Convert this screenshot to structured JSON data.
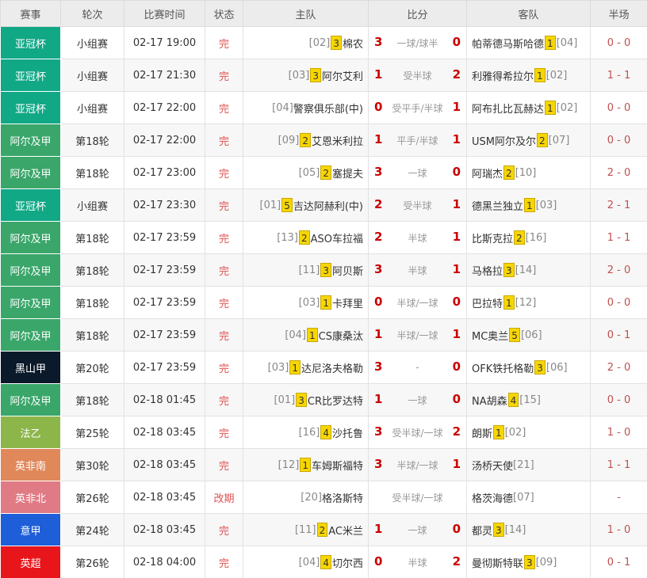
{
  "headers": [
    "赛事",
    "轮次",
    "比赛时间",
    "状态",
    "主队",
    "比分",
    "客队",
    "半场"
  ],
  "colors": {
    "league_afc": "#11a886",
    "league_algeria": "#3aa66a",
    "league_montenegro": "#0b1a2a",
    "league_ligue2": "#8cb64a",
    "league_eng_south": "#e0885a",
    "league_eng_north": "#e07a85",
    "league_serie_a": "#1e5ed8",
    "league_premier": "#e8161b",
    "badge_yellow": "#f7d600",
    "score_red": "#cc0000"
  },
  "matches": [
    {
      "league": "亚冠杯",
      "league_color": "#11a886",
      "round": "小组赛",
      "time": "02-17 19:00",
      "status": "完",
      "home_rank": "[02]",
      "home_badge": "3",
      "home": "棉农",
      "home_score": "3",
      "handicap": "一球/球半",
      "away_score": "0",
      "away": "帕蒂德马斯哈德",
      "away_badge": "1",
      "away_rank": "[04]",
      "half": "0 - 0"
    },
    {
      "league": "亚冠杯",
      "league_color": "#11a886",
      "round": "小组赛",
      "time": "02-17 21:30",
      "status": "完",
      "home_rank": "[03]",
      "home_badge": "3",
      "home": "阿尔艾利",
      "home_score": "1",
      "handicap": "受半球",
      "away_score": "2",
      "away": "利雅得希拉尔",
      "away_badge": "1",
      "away_rank": "[02]",
      "half": "1 - 1"
    },
    {
      "league": "亚冠杯",
      "league_color": "#11a886",
      "round": "小组赛",
      "time": "02-17 22:00",
      "status": "完",
      "home_rank": "[04]",
      "home_badge": "",
      "home": "警察俱乐部(中)",
      "home_score": "0",
      "handicap": "受平手/半球",
      "away_score": "1",
      "away": "阿布扎比瓦赫达",
      "away_badge": "1",
      "away_rank": "[02]",
      "half": "0 - 0"
    },
    {
      "league": "阿尔及甲",
      "league_color": "#3aa66a",
      "round": "第18轮",
      "time": "02-17 22:00",
      "status": "完",
      "home_rank": "[09]",
      "home_badge": "2",
      "home": "艾恩米利拉",
      "home_score": "1",
      "handicap": "平手/半球",
      "away_score": "1",
      "away": "USM阿尔及尔",
      "away_badge": "2",
      "away_rank": "[07]",
      "half": "0 - 0"
    },
    {
      "league": "阿尔及甲",
      "league_color": "#3aa66a",
      "round": "第18轮",
      "time": "02-17 23:00",
      "status": "完",
      "home_rank": "[05]",
      "home_badge": "2",
      "home": "塞提夫",
      "home_score": "3",
      "handicap": "一球",
      "away_score": "0",
      "away": "阿瑞杰",
      "away_badge": "2",
      "away_rank": "[10]",
      "half": "2 - 0"
    },
    {
      "league": "亚冠杯",
      "league_color": "#11a886",
      "round": "小组赛",
      "time": "02-17 23:30",
      "status": "完",
      "home_rank": "[01]",
      "home_badge": "5",
      "home": "吉达阿赫利(中)",
      "home_score": "2",
      "handicap": "受半球",
      "away_score": "1",
      "away": "德黑兰独立",
      "away_badge": "1",
      "away_rank": "[03]",
      "half": "2 - 1"
    },
    {
      "league": "阿尔及甲",
      "league_color": "#3aa66a",
      "round": "第18轮",
      "time": "02-17 23:59",
      "status": "完",
      "home_rank": "[13]",
      "home_badge": "2",
      "home": "ASO车拉福",
      "home_score": "2",
      "handicap": "半球",
      "away_score": "1",
      "away": "比斯克拉",
      "away_badge": "2",
      "away_rank": "[16]",
      "half": "1 - 1"
    },
    {
      "league": "阿尔及甲",
      "league_color": "#3aa66a",
      "round": "第18轮",
      "time": "02-17 23:59",
      "status": "完",
      "home_rank": "[11]",
      "home_badge": "3",
      "home": "阿贝斯",
      "home_score": "3",
      "handicap": "半球",
      "away_score": "1",
      "away": "马格拉",
      "away_badge": "3",
      "away_rank": "[14]",
      "half": "2 - 0"
    },
    {
      "league": "阿尔及甲",
      "league_color": "#3aa66a",
      "round": "第18轮",
      "time": "02-17 23:59",
      "status": "完",
      "home_rank": "[03]",
      "home_badge": "1",
      "home": "卡拜里",
      "home_score": "0",
      "handicap": "半球/一球",
      "away_score": "0",
      "away": "巴拉特",
      "away_badge": "1",
      "away_rank": "[12]",
      "half": "0 - 0"
    },
    {
      "league": "阿尔及甲",
      "league_color": "#3aa66a",
      "round": "第18轮",
      "time": "02-17 23:59",
      "status": "完",
      "home_rank": "[04]",
      "home_badge": "1",
      "home": "CS康桑汰",
      "home_score": "1",
      "handicap": "半球/一球",
      "away_score": "1",
      "away": "MC奥兰",
      "away_badge": "5",
      "away_rank": "[06]",
      "half": "0 - 1"
    },
    {
      "league": "黑山甲",
      "league_color": "#0b1a2a",
      "round": "第20轮",
      "time": "02-17 23:59",
      "status": "完",
      "home_rank": "[03]",
      "home_badge": "1",
      "home": "达尼洛夫格勒",
      "home_score": "3",
      "handicap": "-",
      "away_score": "0",
      "away": "OFK铁托格勒",
      "away_badge": "3",
      "away_rank": "[06]",
      "half": "2 - 0"
    },
    {
      "league": "阿尔及甲",
      "league_color": "#3aa66a",
      "round": "第18轮",
      "time": "02-18 01:45",
      "status": "完",
      "home_rank": "[01]",
      "home_badge": "3",
      "home": "CR比罗达特",
      "home_score": "1",
      "handicap": "一球",
      "away_score": "0",
      "away": "NA胡森",
      "away_badge": "4",
      "away_rank": "[15]",
      "half": "0 - 0"
    },
    {
      "league": "法乙",
      "league_color": "#8cb64a",
      "round": "第25轮",
      "time": "02-18 03:45",
      "status": "完",
      "home_rank": "[16]",
      "home_badge": "4",
      "home": "沙托鲁",
      "home_score": "3",
      "handicap": "受半球/一球",
      "away_score": "2",
      "away": "朗斯",
      "away_badge": "1",
      "away_rank": "[02]",
      "half": "1 - 0"
    },
    {
      "league": "英非南",
      "league_color": "#e0885a",
      "round": "第30轮",
      "time": "02-18 03:45",
      "status": "完",
      "home_rank": "[12]",
      "home_badge": "1",
      "home": "车姆斯福特",
      "home_score": "3",
      "handicap": "半球/一球",
      "away_score": "1",
      "away": "汤桥天使",
      "away_badge": "",
      "away_rank": "[21]",
      "half": "1 - 1"
    },
    {
      "league": "英非北",
      "league_color": "#e07a85",
      "round": "第26轮",
      "time": "02-18 03:45",
      "status": "改期",
      "home_rank": "[20]",
      "home_badge": "",
      "home": "格洛斯特",
      "home_score": "",
      "handicap": "受半球/一球",
      "away_score": "",
      "away": "格茨海德",
      "away_badge": "",
      "away_rank": "[07]",
      "half": "-"
    },
    {
      "league": "意甲",
      "league_color": "#1e5ed8",
      "round": "第24轮",
      "time": "02-18 03:45",
      "status": "完",
      "home_rank": "[11]",
      "home_badge": "2",
      "home": "AC米兰",
      "home_score": "1",
      "handicap": "一球",
      "away_score": "0",
      "away": "都灵",
      "away_badge": "3",
      "away_rank": "[14]",
      "half": "1 - 0"
    },
    {
      "league": "英超",
      "league_color": "#e8161b",
      "round": "第26轮",
      "time": "02-18 04:00",
      "status": "完",
      "home_rank": "[04]",
      "home_badge": "4",
      "home": "切尔西",
      "home_score": "0",
      "handicap": "半球",
      "away_score": "2",
      "away": "曼彻斯特联",
      "away_badge": "3",
      "away_rank": "[09]",
      "half": "0 - 1"
    }
  ]
}
